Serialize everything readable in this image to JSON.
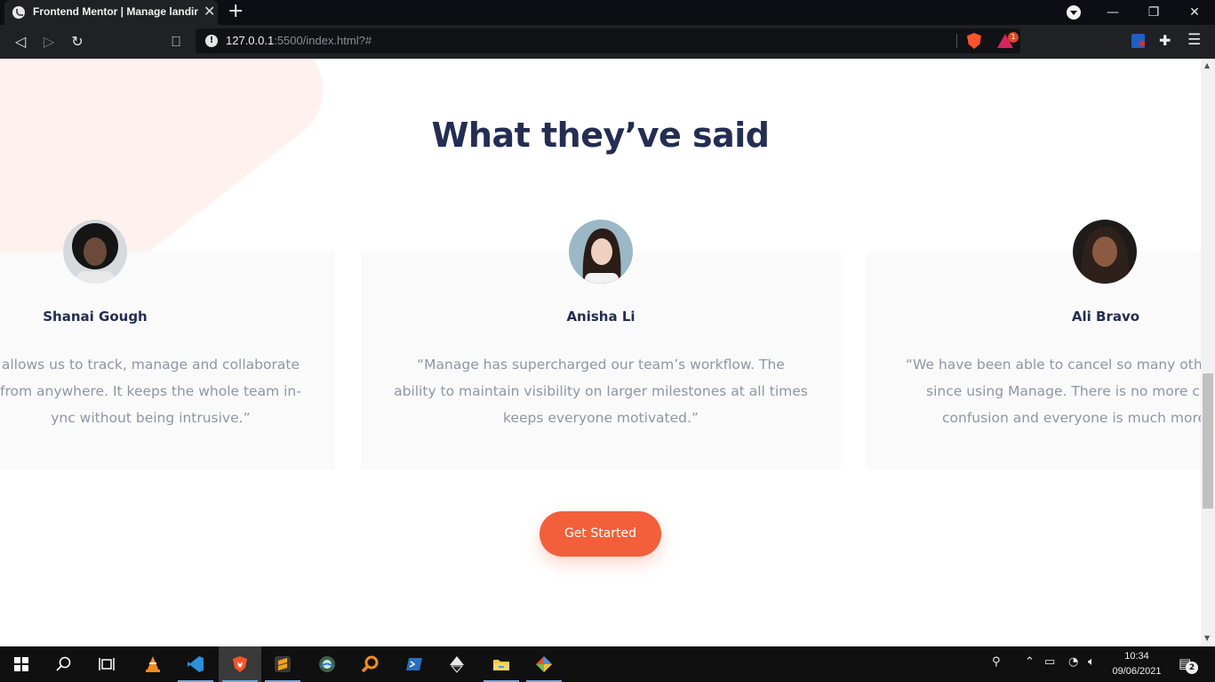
{
  "browser": {
    "tab": {
      "title": "Frontend Mentor | Manage landing page",
      "close_glyph": "✕"
    },
    "new_tab_glyph": "+",
    "window_controls": {
      "minimize": "—",
      "restore": "❐",
      "close": "✕"
    },
    "nav": {
      "back": "◁",
      "forward": "▷",
      "reload": "↻",
      "bookmark": "⎕"
    },
    "address": {
      "host": "127.0.0.1",
      "path": ":5500/index.html?#"
    },
    "rewards_badge": "1",
    "menu_glyph": "☰",
    "puzzle_glyph": "✚"
  },
  "page": {
    "heading": "What they’ve said",
    "testimonials": [
      {
        "name": "Shanai Gough",
        "quote_lines": [
          "allows us to track, manage and collaborate",
          "from anywhere. It keeps the whole team in-",
          "ync without being intrusive.”"
        ]
      },
      {
        "name": "Anisha Li",
        "quote_lines": [
          "“Manage has supercharged our team’s workflow. The",
          "ability to maintain visibility on larger milestones at all times",
          "keeps everyone motivated.”"
        ]
      },
      {
        "name": "Ali Bravo",
        "quote_lines": [
          "“We have been able to cancel so many other",
          "since using Manage. There is no more cro",
          "confusion and everyone is much more"
        ]
      }
    ],
    "cta_label": "Get Started"
  },
  "colors": {
    "heading": "#242d52",
    "body_text": "#9095a7",
    "accent": "#f25f3a",
    "card_bg": "#fafafa",
    "blob": "#fff1ed"
  },
  "taskbar": {
    "apps": [
      "windows-start",
      "search",
      "task-view",
      "vlc",
      "vscode",
      "brave",
      "sublime-text",
      "app-round",
      "search-app",
      "powershell",
      "inkscape",
      "file-explorer",
      "git"
    ],
    "clock": {
      "time": "10:34",
      "date": "09/06/2021"
    },
    "notification_count": "2"
  }
}
